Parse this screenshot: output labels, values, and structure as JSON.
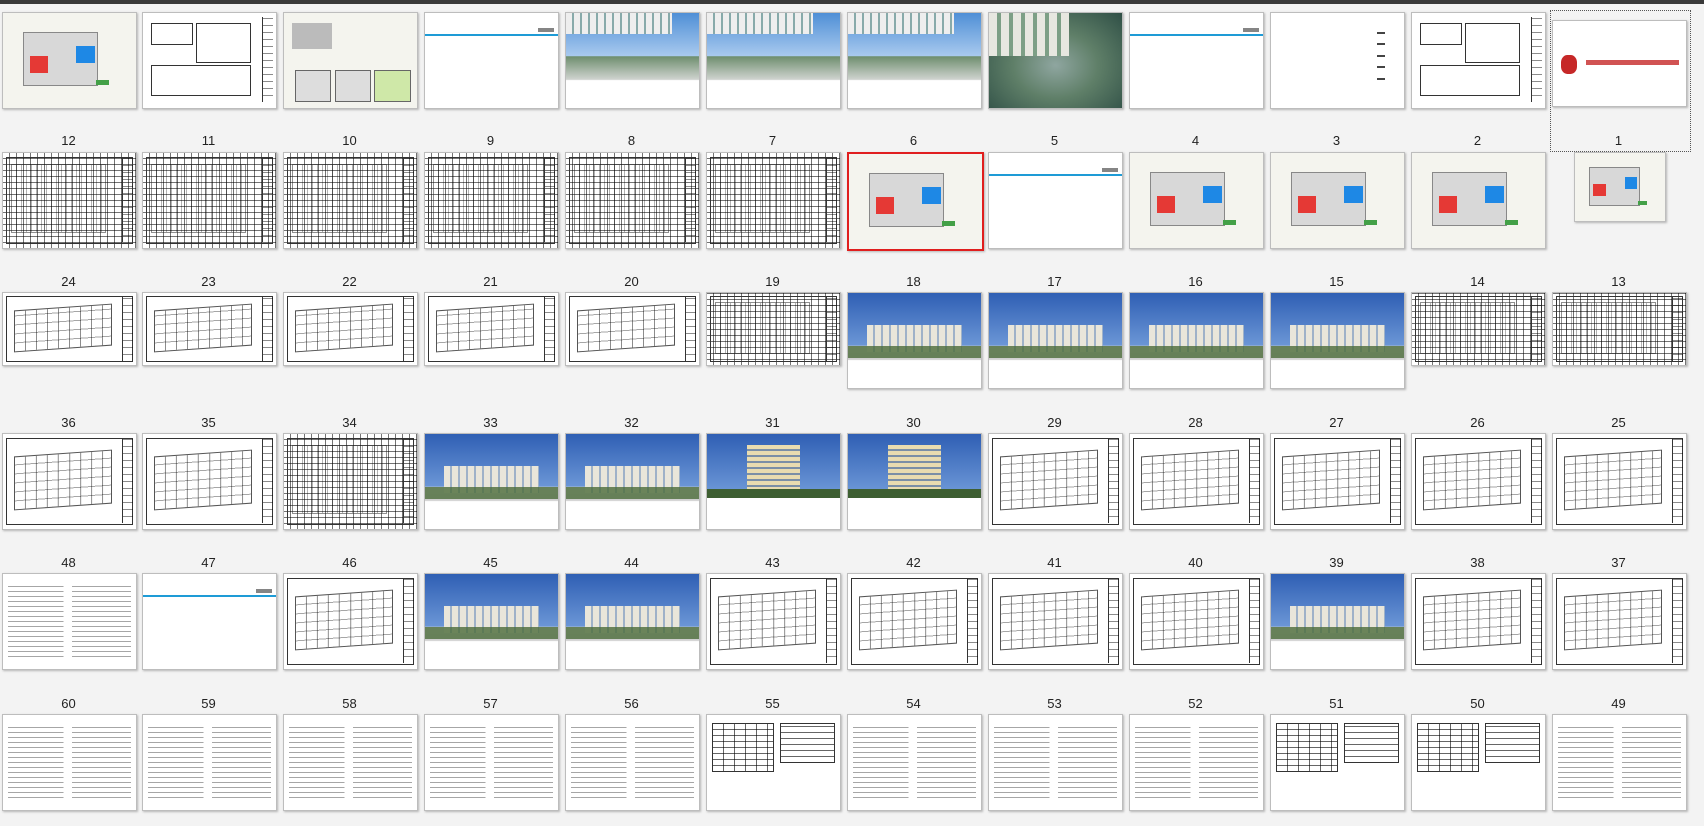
{
  "window": {
    "title": ""
  },
  "selected_page": "6",
  "rows": [
    {
      "labels": [],
      "pages": [
        {
          "num": "",
          "type": "site"
        },
        {
          "num": "",
          "type": "form"
        },
        {
          "num": "",
          "type": "map"
        },
        {
          "num": "",
          "type": "divider"
        },
        {
          "num": "",
          "type": "photo"
        },
        {
          "num": "",
          "type": "photo"
        },
        {
          "num": "",
          "type": "photo"
        },
        {
          "num": "",
          "type": "aerial"
        },
        {
          "num": "",
          "type": "divider"
        },
        {
          "num": "",
          "type": "menu"
        },
        {
          "num": "",
          "type": "form"
        },
        {
          "num": "",
          "type": "cover"
        }
      ]
    },
    {
      "labels": [
        "12",
        "11",
        "10",
        "9",
        "8",
        "7",
        "6",
        "5",
        "4",
        "3",
        "2",
        "1"
      ],
      "pages": [
        {
          "num": "12",
          "type": "plan"
        },
        {
          "num": "11",
          "type": "plan"
        },
        {
          "num": "10",
          "type": "plan"
        },
        {
          "num": "9",
          "type": "plan"
        },
        {
          "num": "8",
          "type": "plan"
        },
        {
          "num": "7",
          "type": "plan"
        },
        {
          "num": "6",
          "type": "site"
        },
        {
          "num": "5",
          "type": "divider"
        },
        {
          "num": "4",
          "type": "site"
        },
        {
          "num": "3",
          "type": "site"
        },
        {
          "num": "2",
          "type": "site"
        },
        {
          "num": "1",
          "type": "site"
        }
      ]
    },
    {
      "labels": [
        "24",
        "23",
        "22",
        "21",
        "20",
        "19",
        "18",
        "17",
        "16",
        "15",
        "14",
        "13"
      ],
      "pages": [
        {
          "num": "24",
          "type": "floor"
        },
        {
          "num": "23",
          "type": "floor"
        },
        {
          "num": "22",
          "type": "floor"
        },
        {
          "num": "21",
          "type": "floor"
        },
        {
          "num": "20",
          "type": "floor"
        },
        {
          "num": "19",
          "type": "plan"
        },
        {
          "num": "18",
          "type": "render"
        },
        {
          "num": "17",
          "type": "render"
        },
        {
          "num": "16",
          "type": "render"
        },
        {
          "num": "15",
          "type": "render"
        },
        {
          "num": "14",
          "type": "plan"
        },
        {
          "num": "13",
          "type": "plan"
        }
      ]
    },
    {
      "labels": [
        "36",
        "35",
        "34",
        "33",
        "32",
        "31",
        "30",
        "29",
        "28",
        "27",
        "26",
        "25"
      ],
      "pages": [
        {
          "num": "36",
          "type": "floor"
        },
        {
          "num": "35",
          "type": "floor"
        },
        {
          "num": "34",
          "type": "plan"
        },
        {
          "num": "33",
          "type": "render"
        },
        {
          "num": "32",
          "type": "render"
        },
        {
          "num": "31",
          "type": "tower"
        },
        {
          "num": "30",
          "type": "tower"
        },
        {
          "num": "29",
          "type": "floor"
        },
        {
          "num": "28",
          "type": "floor"
        },
        {
          "num": "27",
          "type": "floor"
        },
        {
          "num": "26",
          "type": "floor"
        },
        {
          "num": "25",
          "type": "floor"
        }
      ]
    },
    {
      "labels": [
        "48",
        "47",
        "46",
        "45",
        "44",
        "43",
        "42",
        "41",
        "40",
        "39",
        "38",
        "37"
      ],
      "pages": [
        {
          "num": "48",
          "type": "text"
        },
        {
          "num": "47",
          "type": "divider"
        },
        {
          "num": "46",
          "type": "floor"
        },
        {
          "num": "45",
          "type": "render"
        },
        {
          "num": "44",
          "type": "render"
        },
        {
          "num": "43",
          "type": "floor"
        },
        {
          "num": "42",
          "type": "floor"
        },
        {
          "num": "41",
          "type": "floor"
        },
        {
          "num": "40",
          "type": "floor"
        },
        {
          "num": "39",
          "type": "render"
        },
        {
          "num": "38",
          "type": "floor"
        },
        {
          "num": "37",
          "type": "floor"
        }
      ]
    },
    {
      "labels": [
        "60",
        "59",
        "58",
        "57",
        "56",
        "55",
        "54",
        "53",
        "52",
        "51",
        "50",
        "49"
      ],
      "pages": [
        {
          "num": "60",
          "type": "text"
        },
        {
          "num": "59",
          "type": "text"
        },
        {
          "num": "58",
          "type": "text"
        },
        {
          "num": "57",
          "type": "text"
        },
        {
          "num": "56",
          "type": "text"
        },
        {
          "num": "55",
          "type": "table"
        },
        {
          "num": "54",
          "type": "text"
        },
        {
          "num": "53",
          "type": "text"
        },
        {
          "num": "52",
          "type": "text"
        },
        {
          "num": "51",
          "type": "table"
        },
        {
          "num": "50",
          "type": "table"
        },
        {
          "num": "49",
          "type": "text"
        }
      ]
    }
  ],
  "colors": {
    "selection_border": "#e01e1e",
    "divider_accent": "#1e9bd6",
    "cover_accent": "#c62828",
    "sky": "#2f5fb4"
  }
}
